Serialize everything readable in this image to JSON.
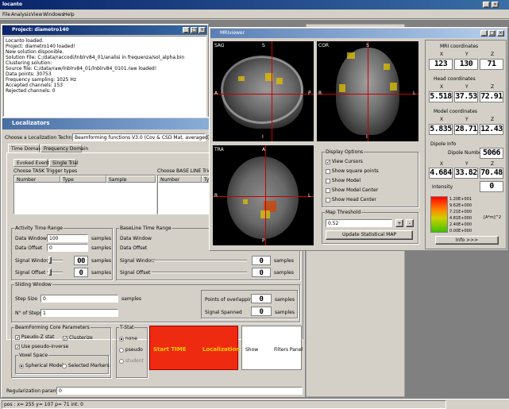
{
  "app": {
    "title": "locanto",
    "menu": [
      "File",
      "Analysis",
      "View",
      "Windows",
      "Help"
    ]
  },
  "project": {
    "title": "Project: diametro140",
    "log": [
      "Locanto loaded.",
      "Project: diametro140 loaded!",
      "New solution disponible.",
      "Solution File: C:/data/raccodi/lnblrv84_01/analisi in frequenza/sol_alpha.bin",
      "Clustering solution:",
      "Source file: C:/data/raw/lnblrv84_01/lnblrv84_0101.raw loaded!",
      "Data points: 30753",
      "Frequency sampling: 1025 Hz",
      "Accepted channels: 153",
      "Rejected channels: 0"
    ]
  },
  "localizators": {
    "title": "Localizators",
    "technique_label": "Choose a Localization Technique",
    "technique_value": "Beamforming functions V3.0 (Cov & CSD Mat. averaged)",
    "tabs": [
      "Time Domain",
      "Frequency Domain"
    ],
    "subtabs": [
      "Evoked Events",
      "Single Trial"
    ],
    "task_label": "Choose TASK Trigger types",
    "baseline_label": "Choose BASE LINE Trigger",
    "cols": [
      "Number",
      "Type",
      "Sample"
    ],
    "cols2": [
      "Number",
      "Ty"
    ],
    "activity": {
      "title": "Activity Time Range",
      "window_label": "Data Window",
      "window_value": "100",
      "offset_label": "Data Offset",
      "offset_value": "0",
      "samples": "samples",
      "sigwin_label": "Signal Window",
      "sigwin_value": "00",
      "sigoff_label": "Signal Offset",
      "sigoff_value": "0"
    },
    "baseline": {
      "title": "BaseLine Time Range",
      "window_label": "Data Window",
      "offset_label": "Data Offset",
      "sigwin_label": "Signal Window",
      "sigoff_label": "Signal Offset",
      "value": "0",
      "samples": "samples"
    },
    "sliding": {
      "title": "Sliding Window",
      "step_label": "Step Size",
      "step_value": "0",
      "samples": "samples",
      "nsteps_label": "N° of Steps",
      "nsteps_value": "1",
      "overlap_label": "Points of overlapping",
      "overlap_value": "0",
      "spanned_label": "Signal Spanned",
      "spanned_value": "0"
    },
    "beam": {
      "title": "BeamForming Core Parameters",
      "pseudoz": "Pseudo-Z stat",
      "cluster": "Clusterize",
      "pseudoinv": "Use pseudo-inverse",
      "voxel": "Voxel Space",
      "spherical": "Spherical Model",
      "selected": "Selected Markers"
    },
    "tstat": {
      "title": "T-Stat",
      "none": "none",
      "pseudo": "pseudo",
      "student": "student"
    },
    "start": "Start TIME",
    "localization": "Localization",
    "show": "Show",
    "filters": "Filters Panel",
    "reg_label": "Regularization parameter",
    "reg_value": "0"
  },
  "status": "pos : x= 255 y= 107 p= 71 int: 0",
  "viewer": {
    "title": "MRIviewer",
    "sag": "SAG",
    "cor": "COR",
    "tra": "TRA",
    "A": "A",
    "P": "P",
    "R": "R",
    "L": "L",
    "S": "S",
    "I": "I",
    "display": {
      "title": "Display Options",
      "view_cursors": "View Cursors",
      "square": "Show square points",
      "model": "Show Model",
      "model_center": "Show Model Center",
      "head_center": "Show Head Center"
    },
    "threshold": {
      "title": "Map Threshold",
      "value": "0.52",
      "plus": "+",
      "minus": "-",
      "update": "Update Statistical MAP"
    },
    "mri": {
      "title": "MRI coordinates",
      "X": "X",
      "Y": "Y",
      "Z": "Z",
      "x": "123",
      "y": "130",
      "z": "71"
    },
    "head": {
      "title": "Head coordinates",
      "x": "5.518",
      "y": "37.53",
      "z": "72.91"
    },
    "model": {
      "title": "Model coordinates",
      "x": "5.835",
      "y": "28.71",
      "z": "12.43"
    },
    "dipole": {
      "title": "Dipole Info",
      "number_label": "Dipole Number",
      "number": "5066",
      "x": "4.684",
      "y": "33.82",
      "z": "70.48",
      "intensity_label": "Intensity",
      "intensity": "0"
    },
    "scale": [
      "1.20E+001",
      "9.62E+000",
      "7.21E+000",
      "4.81E+000",
      "2.40E+000",
      "0.00E+000"
    ],
    "unit": "[A*m]^2",
    "info": "Info >>>"
  }
}
